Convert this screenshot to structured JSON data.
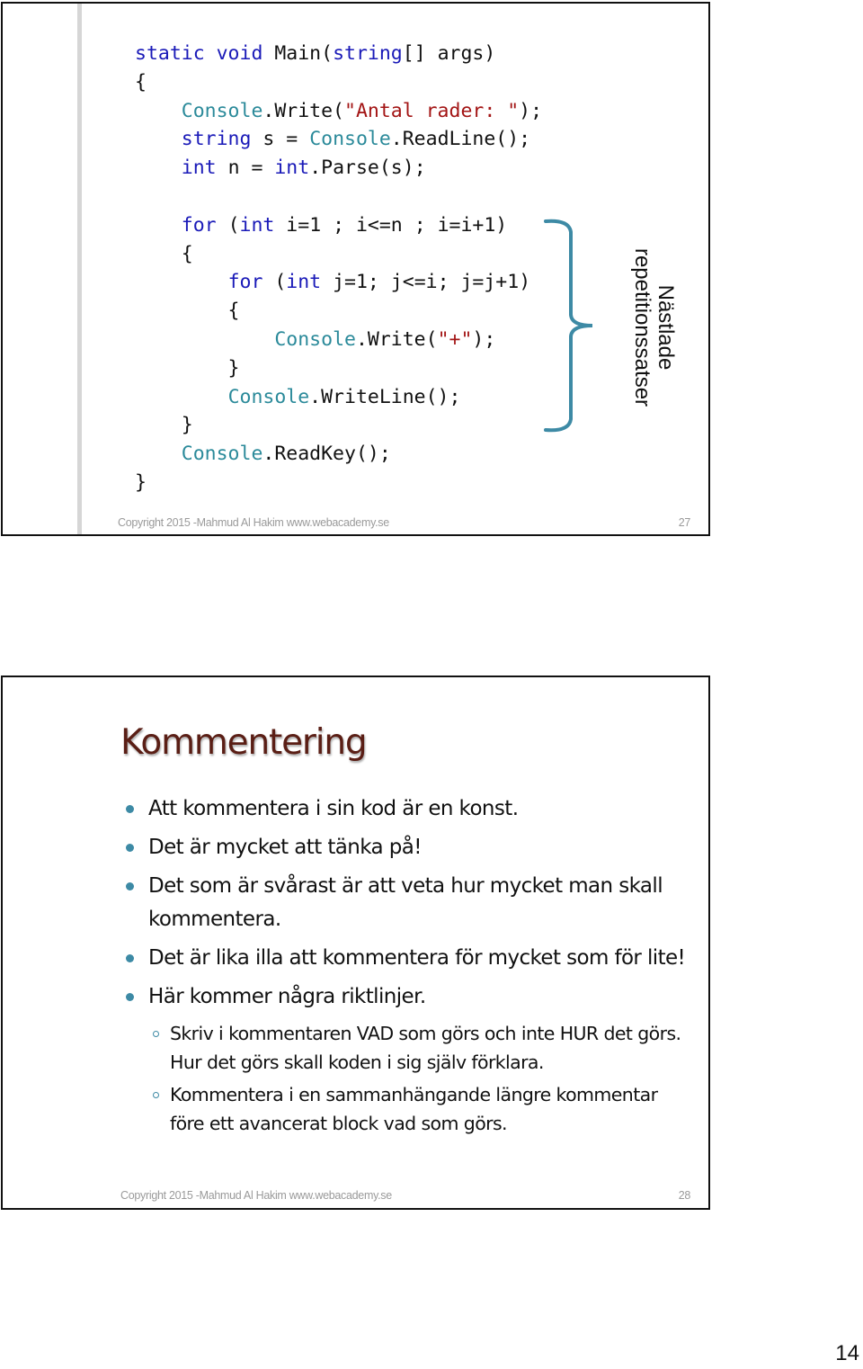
{
  "slides": [
    {
      "number": "27",
      "code_lines": [
        [
          {
            "t": "static void ",
            "c": "kw"
          },
          {
            "t": "Main(",
            "c": ""
          },
          {
            "t": "string",
            "c": "kw"
          },
          {
            "t": "[] args)",
            "c": ""
          }
        ],
        [
          {
            "t": "{",
            "c": ""
          }
        ],
        [
          {
            "t": "    ",
            "c": ""
          },
          {
            "t": "Console",
            "c": "ty"
          },
          {
            "t": ".Write(",
            "c": ""
          },
          {
            "t": "\"Antal rader: \"",
            "c": "str"
          },
          {
            "t": ");",
            "c": ""
          }
        ],
        [
          {
            "t": "    ",
            "c": ""
          },
          {
            "t": "string",
            "c": "kw"
          },
          {
            "t": " s = ",
            "c": ""
          },
          {
            "t": "Console",
            "c": "ty"
          },
          {
            "t": ".ReadLine();",
            "c": ""
          }
        ],
        [
          {
            "t": "    ",
            "c": ""
          },
          {
            "t": "int",
            "c": "kw"
          },
          {
            "t": " n = ",
            "c": ""
          },
          {
            "t": "int",
            "c": "kw"
          },
          {
            "t": ".Parse(s);",
            "c": ""
          }
        ],
        [
          {
            "t": "",
            "c": ""
          }
        ],
        [
          {
            "t": "    ",
            "c": ""
          },
          {
            "t": "for",
            "c": "kw"
          },
          {
            "t": " (",
            "c": ""
          },
          {
            "t": "int",
            "c": "kw"
          },
          {
            "t": " i=1 ; i<=n ; i=i+1)",
            "c": ""
          }
        ],
        [
          {
            "t": "    {",
            "c": ""
          }
        ],
        [
          {
            "t": "        ",
            "c": ""
          },
          {
            "t": "for",
            "c": "kw"
          },
          {
            "t": " (",
            "c": ""
          },
          {
            "t": "int",
            "c": "kw"
          },
          {
            "t": " j=1; j<=i; j=j+1)",
            "c": ""
          }
        ],
        [
          {
            "t": "        {",
            "c": ""
          }
        ],
        [
          {
            "t": "            ",
            "c": ""
          },
          {
            "t": "Console",
            "c": "ty"
          },
          {
            "t": ".Write(",
            "c": ""
          },
          {
            "t": "\"+\"",
            "c": "str"
          },
          {
            "t": ");",
            "c": ""
          }
        ],
        [
          {
            "t": "        }",
            "c": ""
          }
        ],
        [
          {
            "t": "        ",
            "c": ""
          },
          {
            "t": "Console",
            "c": "ty"
          },
          {
            "t": ".WriteLine();",
            "c": ""
          }
        ],
        [
          {
            "t": "    }",
            "c": ""
          }
        ],
        [
          {
            "t": "    ",
            "c": ""
          },
          {
            "t": "Console",
            "c": "ty"
          },
          {
            "t": ".ReadKey();",
            "c": ""
          }
        ],
        [
          {
            "t": "}",
            "c": ""
          }
        ]
      ],
      "annotation": {
        "line1": "Nästlade",
        "line2": "repetitionssatser"
      },
      "footer": "Copyright 2015 -Mahmud Al Hakim www.webacademy.se"
    },
    {
      "number": "28",
      "title": "Kommentering",
      "bullets": [
        {
          "level": 1,
          "text": "Att kommentera i sin kod är en konst."
        },
        {
          "level": 1,
          "text": "Det är mycket att tänka på!"
        },
        {
          "level": 1,
          "text": "Det som är svårast är att veta hur mycket man skall kommentera."
        },
        {
          "level": 1,
          "text": "Det är lika illa att kommentera för mycket som för lite!"
        },
        {
          "level": 1,
          "text": "Här kommer några riktlinjer."
        },
        {
          "level": 2,
          "text": "Skriv i kommentaren VAD som görs och inte HUR det görs. Hur det görs skall koden i sig själv förklara."
        },
        {
          "level": 2,
          "text": "Kommentera i en sammanhängande längre kommentar före ett avancerat block vad som görs."
        }
      ],
      "footer": "Copyright 2015 -Mahmud Al Hakim www.webacademy.se"
    }
  ],
  "page_number": "14",
  "colors": {
    "keyword": "#1a1ab8",
    "type": "#2b8a9a",
    "string": "#a31515",
    "title": "#5a1e15",
    "bullet": "#3d8aa5",
    "brace": "#3d8aa5"
  }
}
